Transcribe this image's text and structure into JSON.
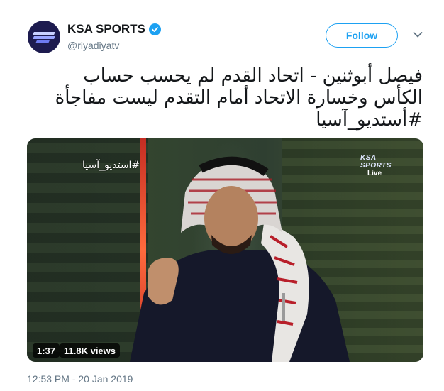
{
  "account": {
    "display_name": "KSA SPORTS",
    "handle": "@riyadiyatv",
    "verified": true,
    "avatar_icon": "ksa-sports-logo-icon"
  },
  "header": {
    "follow_label": "Follow",
    "menu_icon": "chevron-down-icon"
  },
  "tweet": {
    "lines": [
      "فيصل أبوثنين - اتحاد القدم لم يحسب حساب",
      "الكأس وخسارة الاتحاد أمام التقدم ليست مفاجأة",
      "#أستديو_آسيا"
    ],
    "timestamp": "12:53 PM - 20 Jan 2019"
  },
  "video": {
    "overlay_hashtag": "#استديو_آسيا",
    "channel_logo": "KSA SPORTS",
    "live_label": "Live",
    "duration": "1:37",
    "views": "11.8K views"
  },
  "colors": {
    "accent": "#1da1f2",
    "text": "#14171a",
    "muted": "#657786"
  }
}
